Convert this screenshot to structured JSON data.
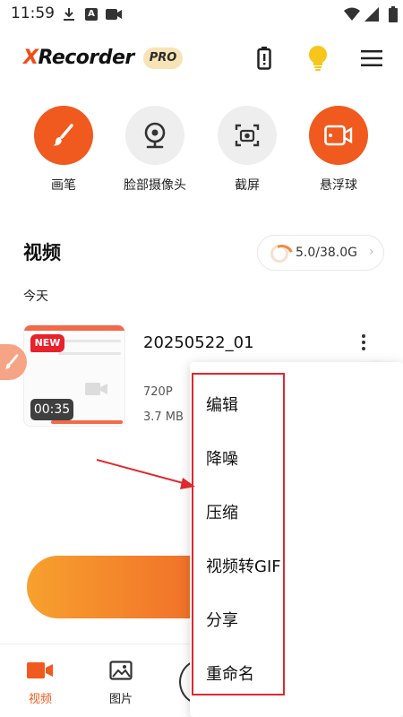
{
  "status_bar": {
    "time": "11:59",
    "a_icon_label": "A"
  },
  "header": {
    "logo_accent": "X",
    "logo_rest": "Recorder",
    "pro_badge": "PRO"
  },
  "tools": [
    {
      "label": "画笔",
      "icon": "brush-icon"
    },
    {
      "label": "脸部摄像头",
      "icon": "webcam-icon"
    },
    {
      "label": "截屏",
      "icon": "screenshot-icon"
    },
    {
      "label": "悬浮球",
      "icon": "floating-camera-icon"
    }
  ],
  "videos_section": {
    "title": "视频",
    "storage": "5.0/38.0G",
    "date_group": "今天"
  },
  "video_item": {
    "badge": "NEW",
    "duration": "00:35",
    "title": "20250522_01",
    "resolution": "720P",
    "size": "3.7 MB"
  },
  "context_menu": {
    "items": [
      "编辑",
      "降噪",
      "压缩",
      "视频转GIF",
      "分享",
      "重命名"
    ]
  },
  "bottom_nav": {
    "video_label": "视频",
    "photo_label": "图片"
  },
  "colors": {
    "accent": "#f05a1f",
    "annotation": "#e0282e",
    "pro_badge_bg": "#f7e3b4"
  }
}
